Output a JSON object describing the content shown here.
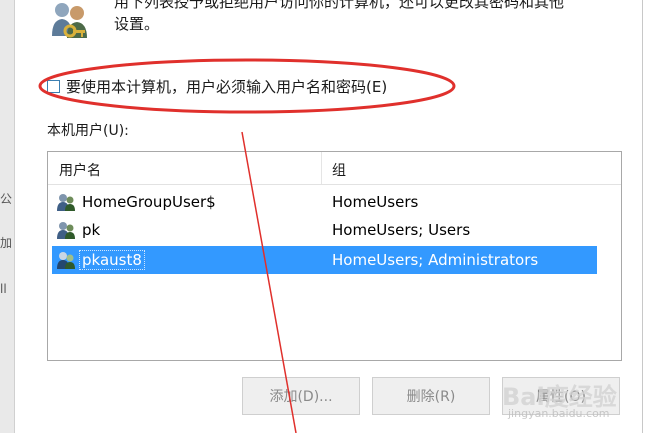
{
  "description": {
    "line1": "用下列表授予或拒绝用户访问你的计算机，还可以更改其密码和其他",
    "line2": "设置。"
  },
  "require_login": {
    "label": "要使用本计算机，用户必须输入用户名和密码(E)",
    "checked": false
  },
  "users_section": {
    "label": "本机用户(U):"
  },
  "user_list": {
    "columns": [
      "用户名",
      "组"
    ],
    "rows": [
      {
        "name": "HomeGroupUser$",
        "group": "HomeUsers",
        "selected": false
      },
      {
        "name": "pk",
        "group": "HomeUsers; Users",
        "selected": false
      },
      {
        "name": "pkaust8",
        "group": "HomeUsers; Administrators",
        "selected": true
      }
    ]
  },
  "buttons": {
    "add": "添加(D)...",
    "remove": "删除(R)",
    "properties": "属性(O)"
  },
  "left_strip_chars": [
    "公",
    "加",
    "ll"
  ],
  "watermark": {
    "main": "Bai度经验",
    "sub": "jingyan.baidu.com"
  },
  "colors": {
    "selection": "#3399ff",
    "annotation": "#e0302c",
    "checkbox_border": "#3c7fb1"
  }
}
